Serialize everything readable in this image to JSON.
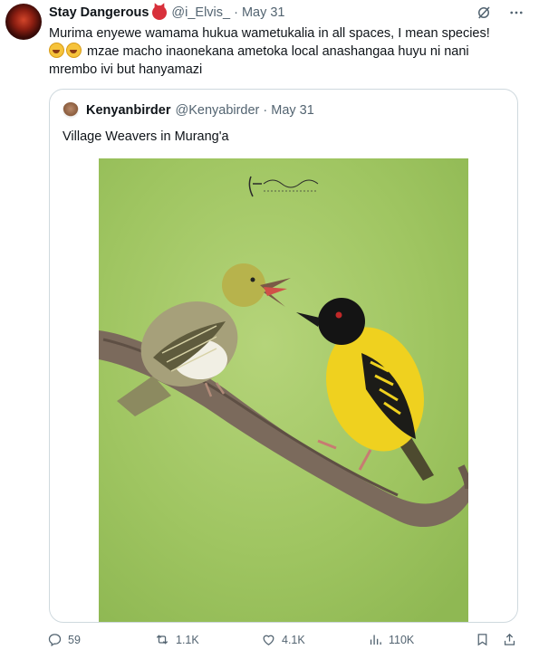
{
  "tweet": {
    "display_name": "Stay Dangerous",
    "handle": "@i_Elvis_",
    "separator": "·",
    "date": "May 31",
    "text_line1": "Murima enyewe wamama hukua wametukalia in all spaces, I mean species!",
    "text_line2": "mzae macho inaonekana ametoka local anashangaa huyu ni nani",
    "text_line3": "mrembo ivi but hanyamazi",
    "emojis": [
      "face-with-tears-of-joy",
      "face-with-tears-of-joy"
    ],
    "name_emoji": "angry-devil-face",
    "top_icons": [
      "grok-slash-icon",
      "more-icon"
    ]
  },
  "quote": {
    "display_name": "Kenyanbirder",
    "handle": "@Kenyabirder",
    "separator": "·",
    "date": "May 31",
    "text": "Village Weavers in Murang'a",
    "image": {
      "watermark_signature": "Simon Odhiambo",
      "watermark_sub": "KENYANBIRDER",
      "colors": {
        "background": "#9fc561",
        "male_body": "#efd11f",
        "male_head": "#141414",
        "branch": "#7b6a5c"
      }
    }
  },
  "actions": {
    "replies": "59",
    "reposts": "1.1K",
    "likes": "4.1K",
    "views": "110K",
    "icons": [
      "reply-icon",
      "repost-icon",
      "like-icon",
      "views-icon",
      "bookmark-icon",
      "share-icon"
    ]
  },
  "colors": {
    "text": "#0f1419",
    "muted": "#536471",
    "border": "#cfd9de"
  }
}
